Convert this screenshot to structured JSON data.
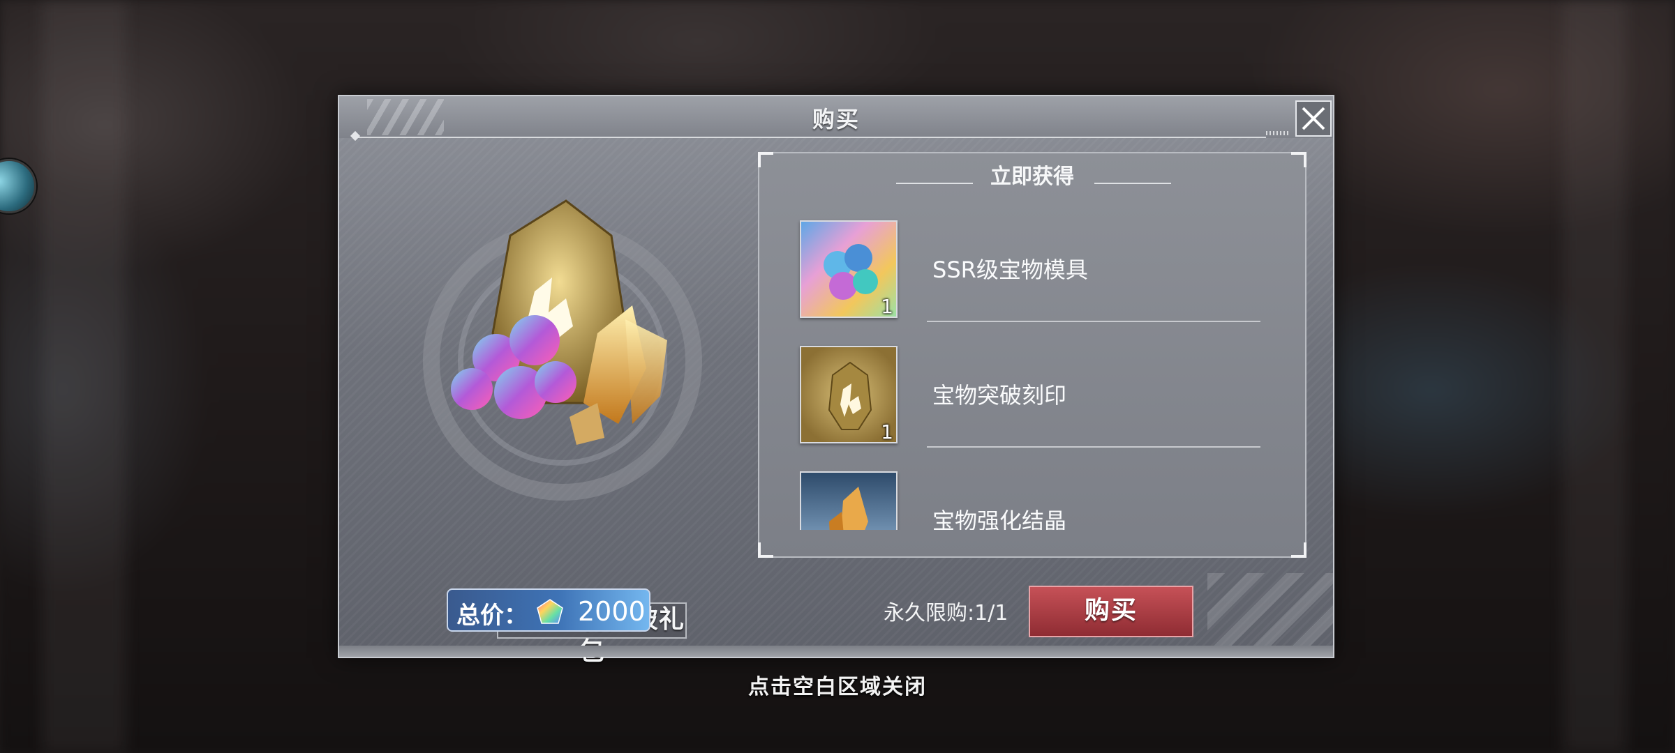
{
  "dialog": {
    "title": "购买"
  },
  "pack": {
    "name": "SSR宝物突破礼包"
  },
  "price": {
    "label": "总价：",
    "value": "2000",
    "currency_icon": "rainbow-gem-icon"
  },
  "rewards": {
    "title": "立即获得",
    "items": [
      {
        "name": "SSR级宝物模具",
        "qty": "1",
        "icon": "gem-cluster-icon"
      },
      {
        "name": "宝物突破刻印",
        "qty": "1",
        "icon": "gold-seal-icon"
      },
      {
        "name": "宝物强化结晶",
        "qty": "",
        "icon": "crystal-icon"
      }
    ]
  },
  "purchase": {
    "limit_text": "永久限购:1/1",
    "buy_label": "购买"
  },
  "footer": {
    "close_hint": "点击空白区域关闭"
  },
  "colors": {
    "buy_button": "#b8434a",
    "price_box": "#3e73b6"
  }
}
